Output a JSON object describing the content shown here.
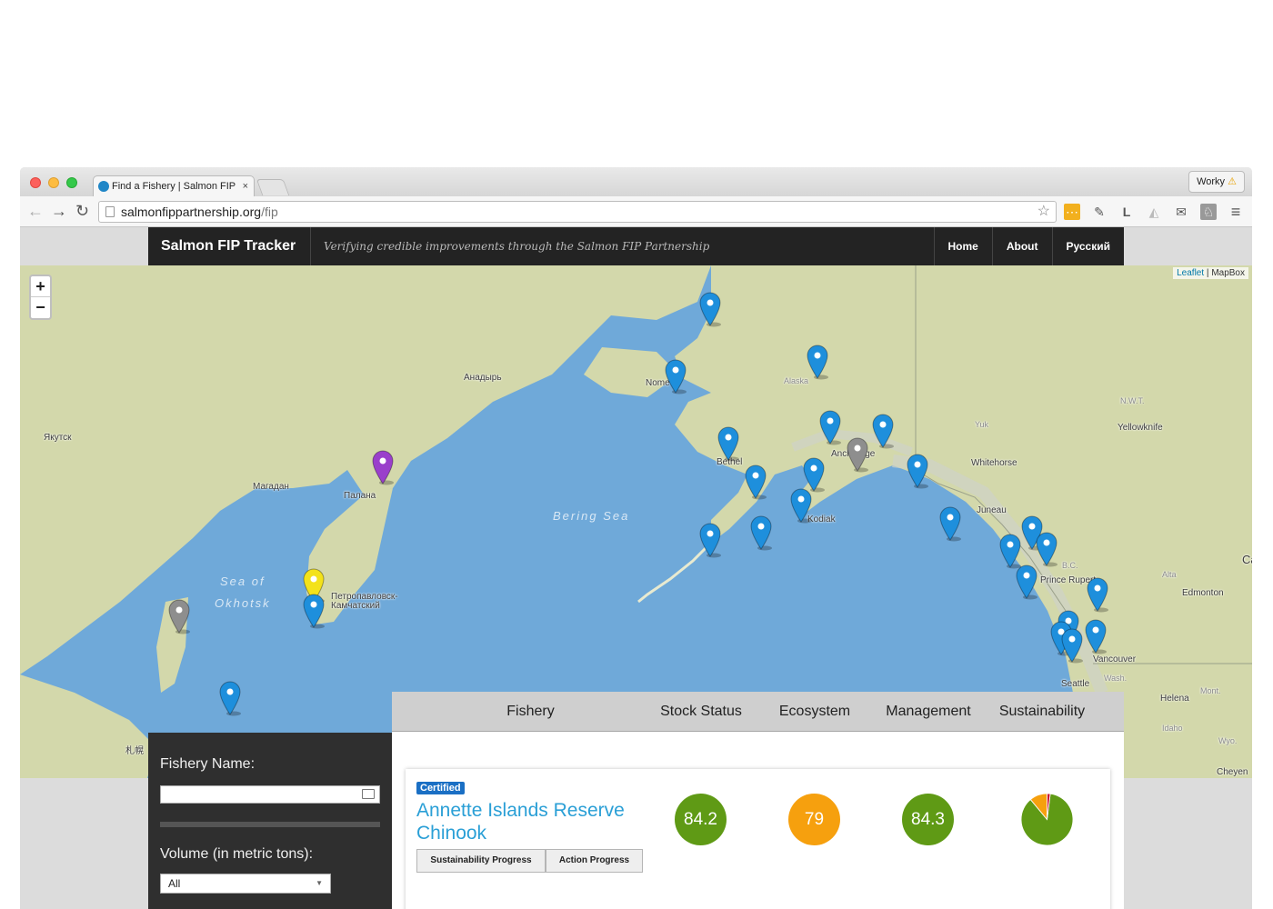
{
  "browser": {
    "tab_title": "Find a Fishery | Salmon FIP",
    "tab_close": "×",
    "profile_name": "Worky",
    "profile_warning": "⚠",
    "url_host": "salmonfippartnership.org",
    "url_path": "/fip",
    "back": "←",
    "forward": "→",
    "reload": "↻",
    "bookmark_star": "☆",
    "extensions": [
      "⋯",
      "✎",
      "L",
      "◭",
      "✉",
      "♘",
      "≡"
    ]
  },
  "site": {
    "brand": "Salmon FIP Tracker",
    "tagline": "Verifying credible improvements through the Salmon FIP Partnership",
    "nav": [
      "Home",
      "About",
      "Русский"
    ]
  },
  "map": {
    "zoom_in": "+",
    "zoom_out": "−",
    "attribution_link": "Leaflet",
    "attribution_sep": " | ",
    "attribution_tiles": "MapBox",
    "seas": {
      "bering": "Bering Sea",
      "okhotsk_1": "Sea of",
      "okhotsk_2": "Okhotsk"
    },
    "places": {
      "anadyr": "Анадырь",
      "nome": "Nome",
      "alaska": "Alaska",
      "yakutsk": "Якутск",
      "magadan": "Магадан",
      "palana": "Палана",
      "bethel": "Bethel",
      "anchorage": "Anchorage",
      "kodiak": "Kodiak",
      "nwt": "N.W.T.",
      "yukon": "Yuk",
      "yellowknife": "Yellowknife",
      "whitehorse": "Whitehorse",
      "juneau": "Juneau",
      "bc": "B.C.",
      "prince_rupert": "Prince Rupert",
      "alta": "Alta",
      "edmonton": "Edmonton",
      "petropavlovsk_1": "Петропавловск-",
      "petropavlovsk_2": "Камчатский",
      "vancouver": "Vancouver",
      "seattle": "Seattle",
      "wash": "Wash.",
      "helena": "Helena",
      "mont": "Mont.",
      "idaho": "Idaho",
      "wyo": "Wyo.",
      "cheyenne": "Cheyen",
      "sapporo": "札幌",
      "ca": "Ca"
    },
    "marker_colors": {
      "blue": "#1e8fdc",
      "purple": "#9a3fcb",
      "yellow": "#f3e21a",
      "gray": "#8e8e8e"
    }
  },
  "filters": {
    "fishery_name_label": "Fishery Name:",
    "fishery_name_value": "",
    "volume_label": "Volume (in metric tons):",
    "volume_selected": "All",
    "volume_caret": "▼"
  },
  "results": {
    "columns": [
      "Fishery",
      "Stock Status",
      "Ecosystem",
      "Management",
      "Sustainability"
    ],
    "rows": [
      {
        "badge": "Certified",
        "name": "Annette Islands Reserve Chinook",
        "stock_status": "84.2",
        "ecosystem": "79",
        "management": "84.3",
        "buttons": [
          "Sustainability Progress",
          "Action Progress"
        ],
        "colors": {
          "stock": "#5f9a15",
          "ecosystem": "#f6a00e",
          "management": "#5f9a15"
        },
        "sustainability_pie": {
          "green": 0.87,
          "orange": 0.11,
          "red": 0.02
        }
      }
    ]
  }
}
